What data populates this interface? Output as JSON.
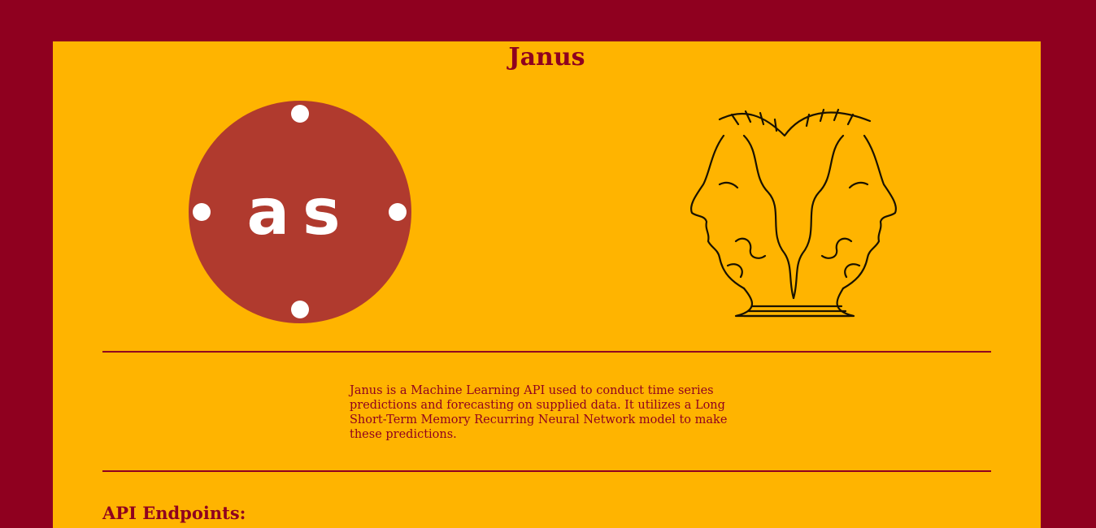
{
  "page": {
    "title": "Janus",
    "description": "Janus is a Machine Learning API used to conduct time series predictions and forecasting on supplied data. It utilizes a Long Short-Term Memory Recurring Neural Network model to make these predictions.",
    "api_heading": "API Endpoints:"
  },
  "logo": {
    "text": "as",
    "icon": "as-circle-logo"
  },
  "illustration": {
    "icon": "two-faced-janus-head"
  },
  "colors": {
    "background": "#8f001f",
    "panel": "#ffb400",
    "logo_circle": "#b03a2e",
    "text": "#8f001f"
  }
}
